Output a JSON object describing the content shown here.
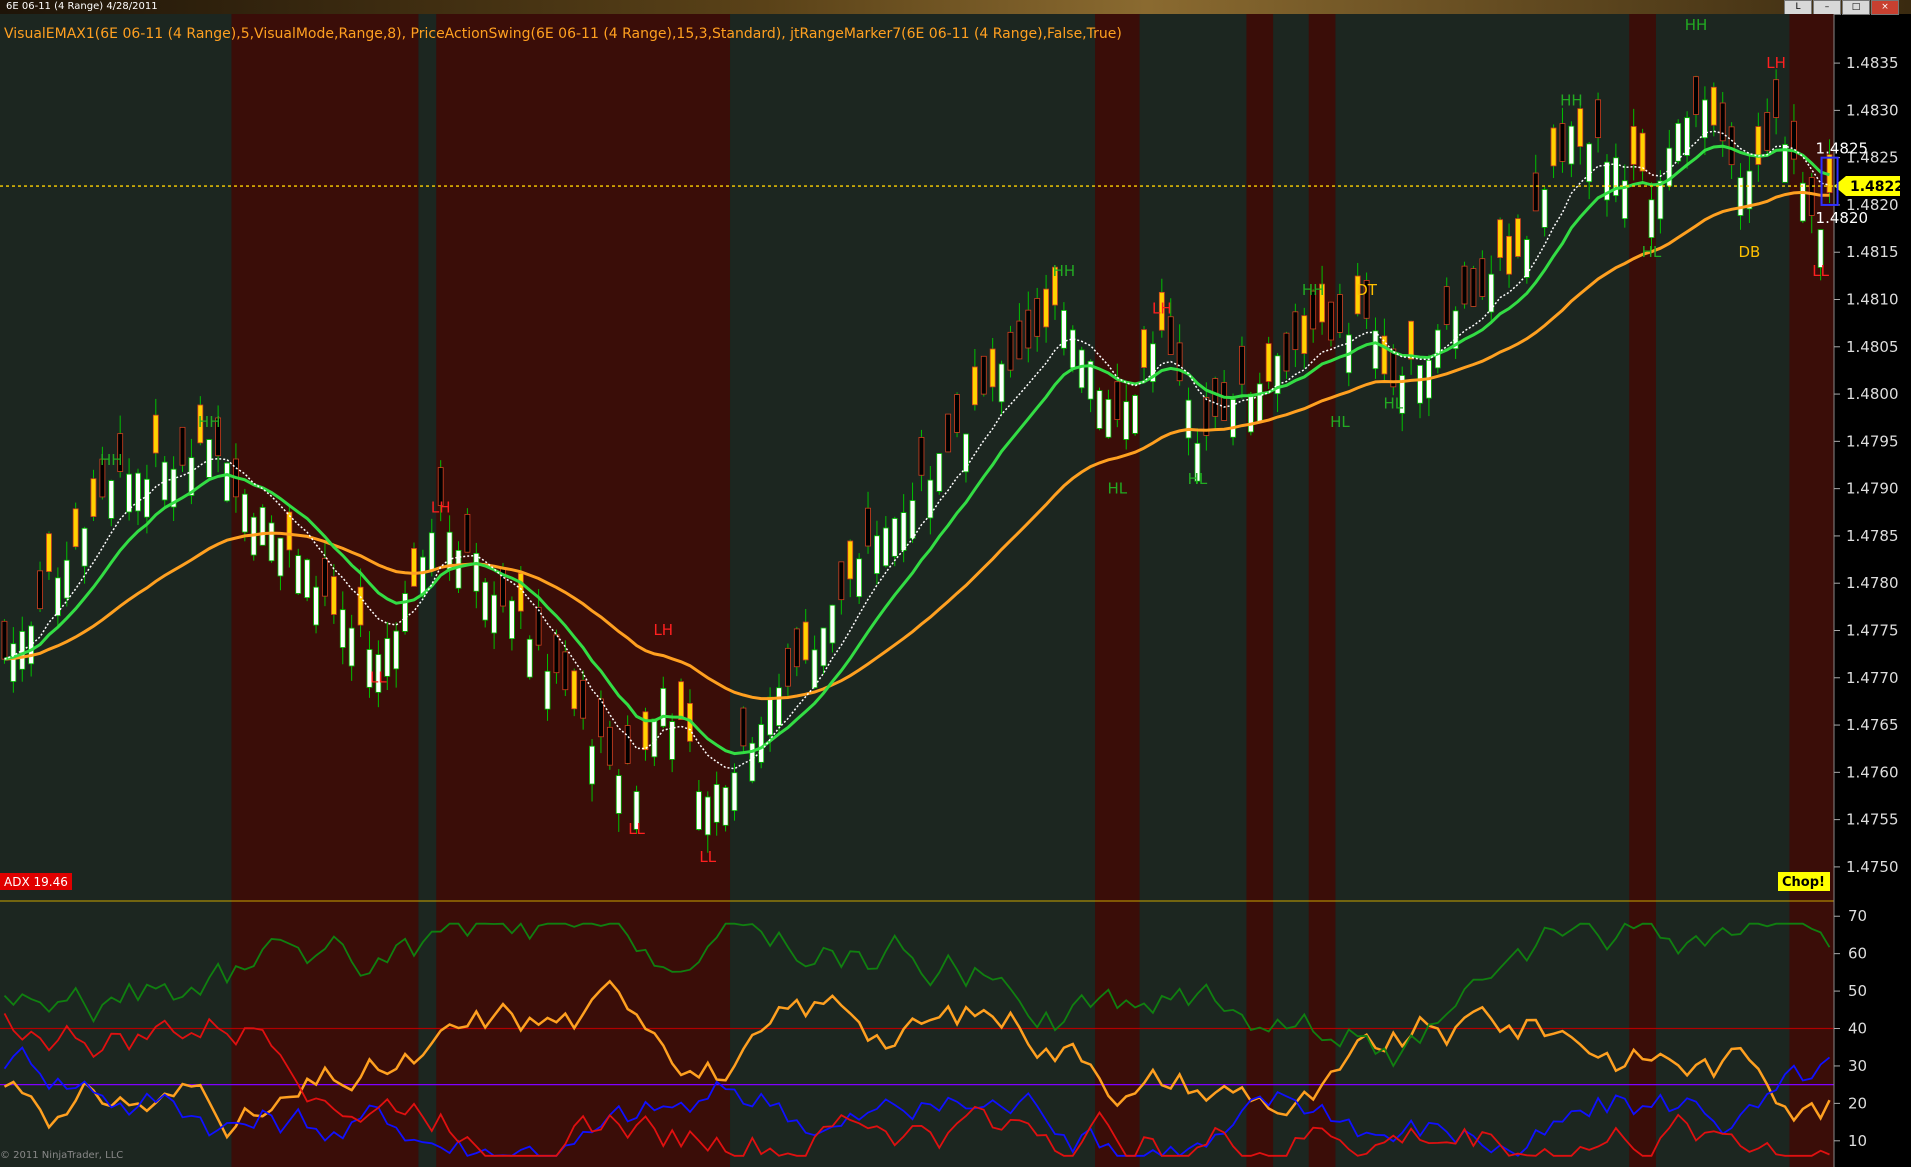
{
  "window": {
    "title": "6E 06-11 (4 Range)  4/28/2011",
    "buttons": [
      "L",
      "–",
      "□",
      "×"
    ]
  },
  "indicator_label": "VisualEMAX1(6E 06-11 (4 Range),5,VisualMode,Range,8), PriceActionSwing(6E 06-11 (4 Range),15,3,Standard), jtRangeMarker7(6E 06-11 (4 Range),False,True)",
  "adx_badge": "ADX 19.46",
  "chop_badge": "Chop!",
  "copyright": "© 2011 NinjaTrader, LLC",
  "current_price": "1.4822",
  "range_top": "1.4825",
  "range_bottom": "1.4820",
  "colors": {
    "bull_body": "#ffffff",
    "bear_body": "#000000",
    "wick": "#00c000",
    "up_strong": "#ffd200",
    "ema_fast": "#33dd44",
    "ema_slow": "#ffa020",
    "ema_red": "#ff2020",
    "trend_bg": "#1c2620",
    "chop_bg": "#3a0d08"
  },
  "chart_data": [
    {
      "type": "candlestick",
      "title": "",
      "price_axis_labels": [
        "1.4835",
        "1.4830",
        "1.4825",
        "1.4820",
        "1.4815",
        "1.4810",
        "1.4805",
        "1.4800",
        "1.4795",
        "1.4790",
        "1.4785",
        "1.4780",
        "1.4775",
        "1.4770",
        "1.4765",
        "1.4760",
        "1.4755",
        "1.4750"
      ],
      "ylim": [
        1.47465,
        1.48385
      ],
      "swing_labels": [
        {
          "text": "HH",
          "bar": 12,
          "price": 1.47925
        },
        {
          "text": "HH",
          "bar": 23,
          "price": 1.47965
        },
        {
          "text": "LH",
          "bar": 49,
          "price": 1.47875
        },
        {
          "text": "LL",
          "bar": 42,
          "price": 1.47695
        },
        {
          "text": "LH",
          "bar": 74,
          "price": 1.47745
        },
        {
          "text": "LL",
          "bar": 71,
          "price": 1.47535
        },
        {
          "text": "LL",
          "bar": 79,
          "price": 1.47505
        },
        {
          "text": "HH",
          "bar": 119,
          "price": 1.48125
        },
        {
          "text": "LH",
          "bar": 130,
          "price": 1.48085
        },
        {
          "text": "HL",
          "bar": 125,
          "price": 1.47895
        },
        {
          "text": "HL",
          "bar": 134,
          "price": 1.47905
        },
        {
          "text": "HH",
          "bar": 147,
          "price": 1.48105
        },
        {
          "text": "DT",
          "bar": 153,
          "price": 1.48105
        },
        {
          "text": "HL",
          "bar": 150,
          "price": 1.47965
        },
        {
          "text": "HL",
          "bar": 156,
          "price": 1.47985
        },
        {
          "text": "HH",
          "bar": 176,
          "price": 1.48305
        },
        {
          "text": "HL",
          "bar": 185,
          "price": 1.48145
        },
        {
          "text": "HH",
          "bar": 190,
          "price": 1.48385
        },
        {
          "text": "LH",
          "bar": 199,
          "price": 1.48345
        },
        {
          "text": "DB",
          "bar": 196,
          "price": 1.48145
        },
        {
          "text": "LL",
          "bar": 204,
          "price": 1.48125
        }
      ],
      "regions": [
        {
          "kind": "chop",
          "from": 26,
          "to": 46
        },
        {
          "kind": "chop",
          "from": 49,
          "to": 81
        },
        {
          "kind": "chop",
          "from": 123,
          "to": 127
        },
        {
          "kind": "chop",
          "from": 140,
          "to": 142
        },
        {
          "kind": "chop",
          "from": 147,
          "to": 149
        },
        {
          "kind": "chop",
          "from": 183,
          "to": 185
        },
        {
          "kind": "chop",
          "from": 201,
          "to": 205
        }
      ]
    },
    {
      "type": "line",
      "title": "",
      "y_axis_labels": [
        "70",
        "60",
        "50",
        "40",
        "30",
        "20",
        "10"
      ],
      "ylim": [
        3,
        73
      ],
      "reference_lines": [
        {
          "value": 40,
          "color": "#b00000"
        },
        {
          "value": 25,
          "color": "#8000ff"
        }
      ],
      "series_colors": [
        "#ffa020",
        "#1010ff",
        "#e01010",
        "#108010"
      ]
    }
  ]
}
